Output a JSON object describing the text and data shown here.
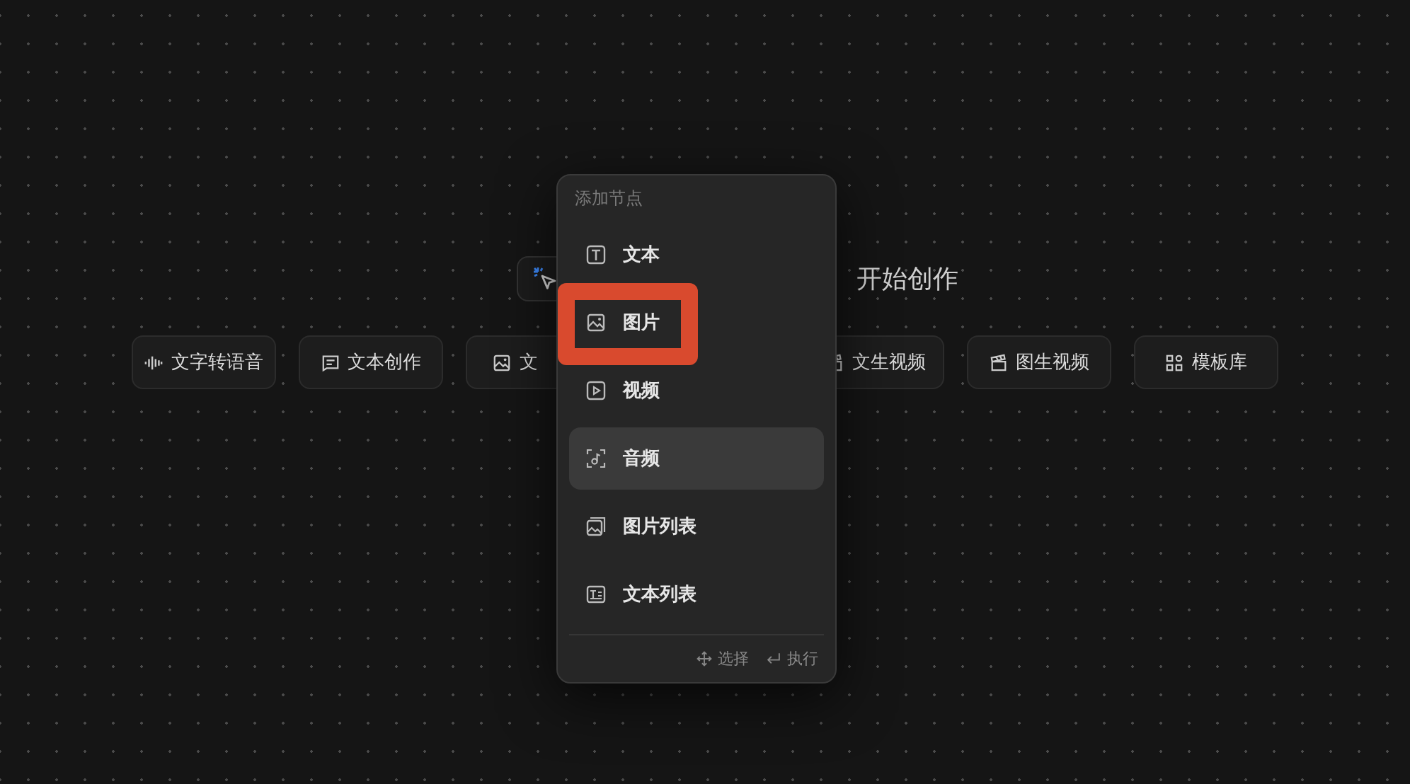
{
  "hint": {
    "trailing_text": "开始创作"
  },
  "quick_actions": [
    {
      "label": "文字转语音",
      "kind": "wave"
    },
    {
      "label": "文本创作",
      "kind": "note"
    },
    {
      "label": "文",
      "kind": "image"
    },
    {
      "label": "文生视频",
      "kind": "clapper"
    },
    {
      "label": "图生视频",
      "kind": "clapper"
    },
    {
      "label": "模板库",
      "kind": "grid"
    }
  ],
  "menu": {
    "title": "添加节点",
    "items": [
      {
        "label": "文本",
        "kind": "text",
        "selected": false,
        "highlighted": false
      },
      {
        "label": "图片",
        "kind": "image",
        "selected": false,
        "highlighted": true
      },
      {
        "label": "视频",
        "kind": "video",
        "selected": false,
        "highlighted": false
      },
      {
        "label": "音频",
        "kind": "audio",
        "selected": true,
        "highlighted": false
      },
      {
        "label": "图片列表",
        "kind": "imagelist",
        "selected": false,
        "highlighted": false
      },
      {
        "label": "文本列表",
        "kind": "textlist",
        "selected": false,
        "highlighted": false
      }
    ],
    "footer": [
      {
        "label": "选择",
        "kind": "move"
      },
      {
        "label": "执行",
        "kind": "enter"
      }
    ]
  }
}
